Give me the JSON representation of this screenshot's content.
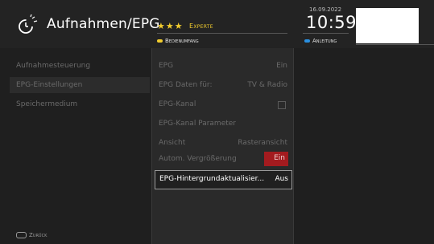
{
  "header": {
    "title": "Aufnahmen/EPG",
    "stars": "★★★",
    "level": "Experte",
    "yellow_hint": "Bedienumfang",
    "date": "16.09.2022",
    "time": "10:59",
    "blue_hint": "Anleitung",
    "colors": {
      "yellow": "#f2cc2e",
      "blue": "#2a8fe0",
      "accent_red": "#a31b1f"
    }
  },
  "sidebar": {
    "items": [
      {
        "label": "Aufnahmesteuerung"
      },
      {
        "label": "EPG-Einstellungen"
      },
      {
        "label": "Speichermedium"
      }
    ]
  },
  "settings": {
    "rows": [
      {
        "label": "EPG",
        "value": "Ein"
      },
      {
        "label": "EPG Daten für:",
        "value": "TV & Radio"
      },
      {
        "label": "EPG-Kanal",
        "value": ""
      },
      {
        "label": "EPG-Kanal Parameter",
        "value": ""
      },
      {
        "label": "Ansicht",
        "value": "Rasteransicht"
      },
      {
        "label": "Autom. Vergrößerung",
        "value": "Ein"
      },
      {
        "label": "EPG-Hintergrundaktualisier...",
        "value": "Aus"
      }
    ]
  },
  "footer": {
    "back_label": "Zurück"
  }
}
